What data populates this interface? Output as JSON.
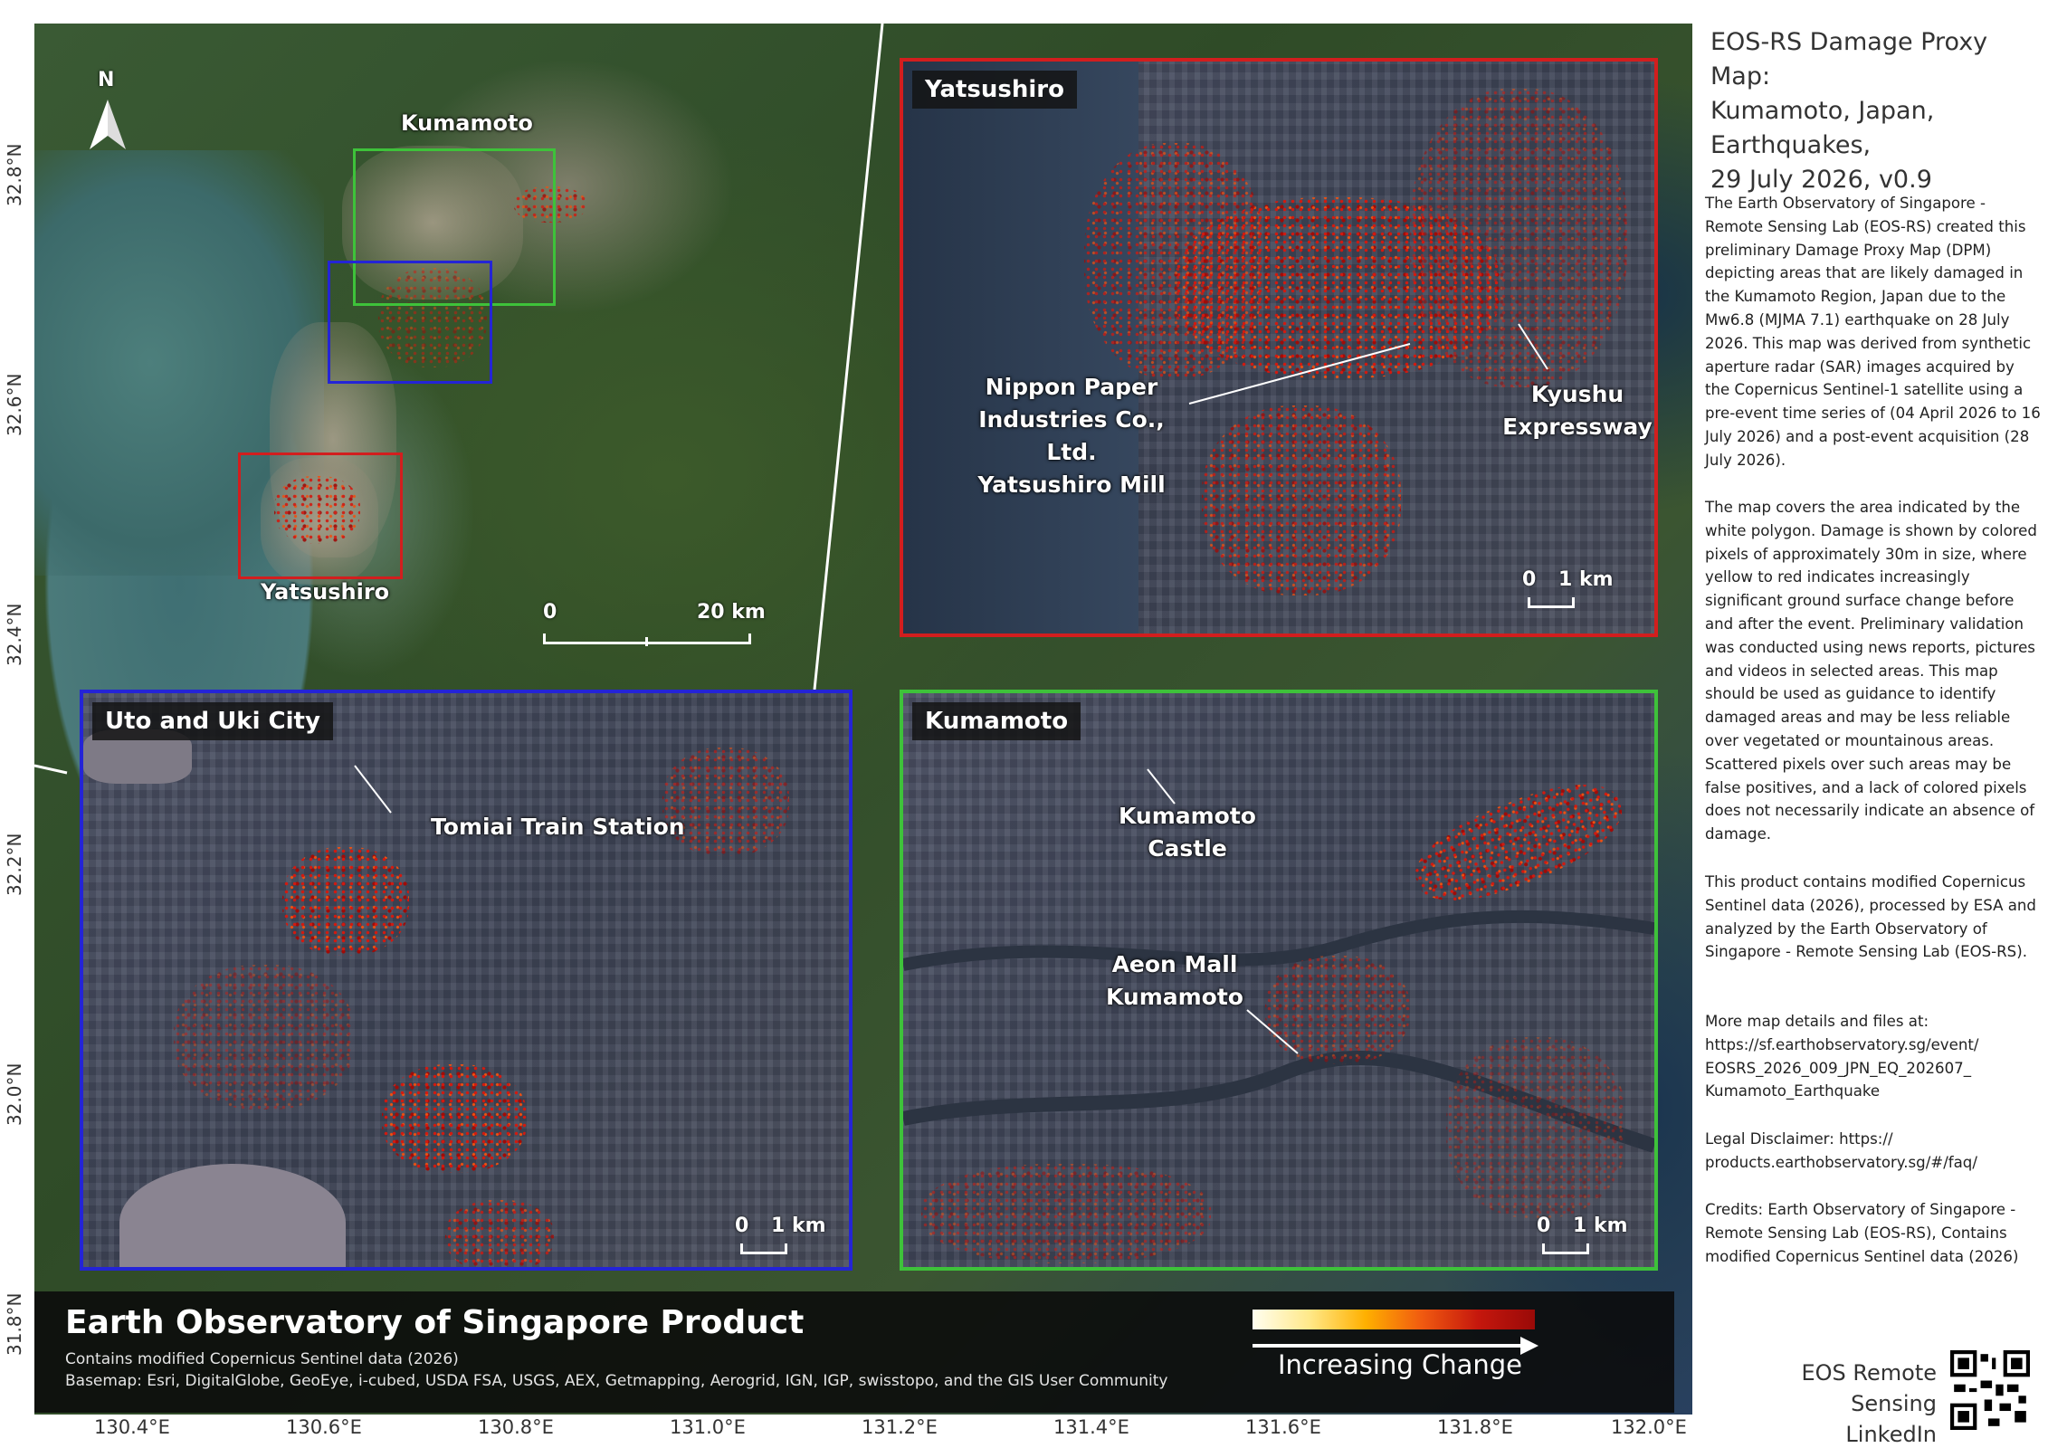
{
  "side_panel": {
    "title_lines": [
      "EOS-RS Damage Proxy Map:",
      "Kumamoto, Japan,",
      "Earthquakes,",
      "29 July 2026, v0.9"
    ],
    "paragraphs": [
      "The Earth Observatory of Singapore - Remote Sensing Lab (EOS-RS) created this preliminary Damage Proxy Map (DPM) depicting areas that are likely damaged in the Kumamoto Region, Japan due to the Mw6.8 (MJMA 7.1) earthquake on 28 July 2026. This map was derived from synthetic aperture radar (SAR) images acquired by the Copernicus Sentinel-1 satellite using a pre-event time series of (04 April 2026 to 16 July 2026) and a post-event acquisition (28 July 2026).",
      "The map covers the area indicated by the white polygon. Damage is shown by colored pixels of approximately 30m in size, where yellow to red indicates increasingly significant ground surface change before and after the event. Preliminary validation was conducted using news reports, pictures and videos in selected areas. This map should be used as guidance to identify damaged areas and may be less reliable over vegetated or mountainous areas. Scattered pixels over such areas may be false positives, and a lack of colored pixels does not necessarily indicate an absence of damage.",
      "This product contains modified Copernicus Sentinel data (2026), processed by ESA and analyzed by the Earth Observatory of Singapore - Remote Sensing Lab (EOS-RS).",
      "More map details and files at: https://sf.earthobservatory.sg/event/ EOSRS_2026_009_JPN_EQ_202607_ Kumamoto_Earthquake",
      "Legal Disclaimer: https:// products.earthobservatory.sg/#/faq/",
      "Credits: Earth Observatory of Singapore - Remote Sensing Lab (EOS-RS), Contains modified Copernicus Sentinel data (2026)"
    ],
    "footer_lines": [
      "EOS Remote Sensing",
      "LinkedIn"
    ]
  },
  "overview": {
    "north_label": "N",
    "kumamoto_label": "Kumamoto",
    "yatsushiro_label": "Yatsushiro",
    "scale_zero": "0",
    "scale_end": "20 km"
  },
  "insets": {
    "yatsushiro": {
      "title": "Yatsushiro",
      "callout_mill": [
        "Nippon Paper",
        "Industries Co., Ltd.",
        "Yatsushiro Mill"
      ],
      "callout_expressway": [
        "Kyushu",
        "Expressway"
      ],
      "scale_zero": "0",
      "scale_end": "1 km"
    },
    "uto": {
      "title": "Uto and Uki City",
      "callout_station": "Tomiai Train Station",
      "scale_zero": "0",
      "scale_end": "1 km"
    },
    "kumamoto": {
      "title": "Kumamoto",
      "callout_castle": [
        "Kumamoto",
        "Castle"
      ],
      "callout_mall": [
        "Aeon Mall",
        "Kumamoto"
      ],
      "scale_zero": "0",
      "scale_end": "1 km"
    }
  },
  "banner": {
    "title": "Earth Observatory of Singapore Product",
    "line1": "Contains modified Copernicus Sentinel data (2026)",
    "line2": "Basemap: Esri, DigitalGlobe, GeoEye, i-cubed, USDA FSA, USGS, AEX, Getmapping, Aerogrid, IGN, IGP, swisstopo, and the GIS User Community",
    "legend_label": "Increasing Change"
  },
  "axes": {
    "lat_ticks": [
      "32.8°N",
      "32.6°N",
      "32.4°N",
      "32.2°N",
      "32.0°N",
      "31.8°N"
    ],
    "lon_ticks": [
      "130.4°E",
      "130.6°E",
      "130.8°E",
      "131.0°E",
      "131.2°E",
      "131.4°E",
      "131.6°E",
      "131.8°E",
      "132.0°E"
    ]
  },
  "colors": {
    "inset_yatsushiro": "#d21e1e",
    "inset_uto": "#2424d6",
    "inset_kumamoto": "#3ec23a",
    "legend_low": "#fffef0",
    "legend_high": "#9a0a08"
  }
}
